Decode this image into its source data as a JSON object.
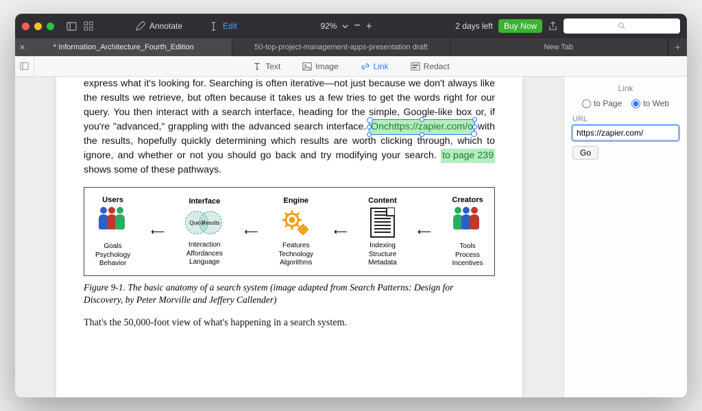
{
  "titlebar": {
    "annotate_label": "Annotate",
    "edit_label": "Edit",
    "zoom_value": "92%",
    "trial_text": "2 days left",
    "buy_label": "Buy Now"
  },
  "tabs": [
    {
      "label": "* Information_Architecture_Fourth_Edition",
      "active": true,
      "closable": true
    },
    {
      "label": "50-top-project-management-apps-presentation draft",
      "active": false
    },
    {
      "label": "New Tab",
      "active": false
    }
  ],
  "toolbar": {
    "text_label": "Text",
    "image_label": "Image",
    "link_label": "Link",
    "redact_label": "Redact"
  },
  "document": {
    "paragraph1_a": "express what it's looking for. Searching is often iterative—not just because we don't always like the results we retrieve, but often because it takes us a few tries to get the words right for our query. You then interact with a search interface, heading for the simple, Google-like box or, if you're \"advanced,\" grappling with the advanced search interface. ",
    "link1_text": "Onchttps://zapier.com/o",
    "paragraph1_b": " with the results, hopefully quickly determining which results are worth clicking through, which to ignore, and whether or not you should go back and try modifying your search. ",
    "link2_text": "to page 239",
    "paragraph1_c": " shows some of these pathways.",
    "figure": {
      "cols": [
        {
          "head": "Users",
          "sub": "Goals\nPsychology\nBehavior"
        },
        {
          "head": "Interface",
          "sub": "Interaction\nAffordances\nLanguage",
          "venn": [
            "Query",
            "Results"
          ]
        },
        {
          "head": "Engine",
          "sub": "Features\nTechnology\nAlgorithms"
        },
        {
          "head": "Content",
          "sub": "Indexing\nStructure\nMetadata"
        },
        {
          "head": "Creators",
          "sub": "Tools\nProcess\nIncentives"
        }
      ]
    },
    "figcaption": "Figure 9-1. The basic anatomy of a search system (image adapted from Search Patterns: Design for Discovery, by Peter Morville and Jeffery Callender)",
    "paragraph2": "That's the 50,000-foot view of what's happening in a search system."
  },
  "sidepanel": {
    "title": "Link",
    "to_page_label": "to Page",
    "to_web_label": "to Web",
    "selected": "to_web",
    "url_label": "URL",
    "url_value": "https://zapier.com/",
    "go_label": "Go"
  }
}
